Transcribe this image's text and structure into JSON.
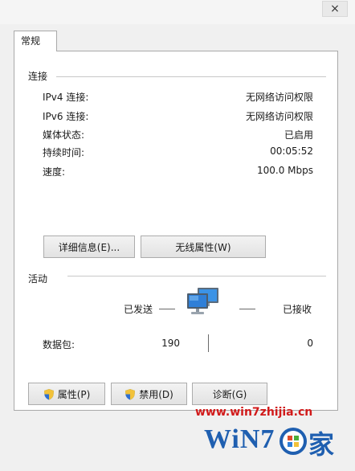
{
  "window": {
    "title": "",
    "close_label": "×"
  },
  "tab": {
    "label": "常规"
  },
  "connection": {
    "section_label": "连接",
    "rows": [
      {
        "label": "IPv4 连接:",
        "value": "无网络访问权限"
      },
      {
        "label": "IPv6 连接:",
        "value": "无网络访问权限"
      },
      {
        "label": "媒体状态:",
        "value": "已启用"
      },
      {
        "label": "持续时间:",
        "value": "00:05:52"
      },
      {
        "label": "速度:",
        "value": "100.0 Mbps"
      }
    ],
    "details_button": "详细信息(E)...",
    "wireless_button": "无线属性(W)"
  },
  "activity": {
    "section_label": "活动",
    "sent_label": "已发送",
    "received_label": "已接收",
    "packets_label": "数据包:",
    "packets_sent": "190",
    "packets_received": "0"
  },
  "buttons": {
    "properties": "属性(P)",
    "disable": "禁用(D)",
    "diagnose": "诊断(G)"
  },
  "watermark": {
    "url": "www.win7zhijia.cn",
    "logo_text": "WiN7",
    "logo_suffix": "家"
  },
  "colors": {
    "watermark_red": "#d11a1a",
    "logo_blue": "#1f5fb0",
    "monitor_blue": "#2f7fd8"
  }
}
